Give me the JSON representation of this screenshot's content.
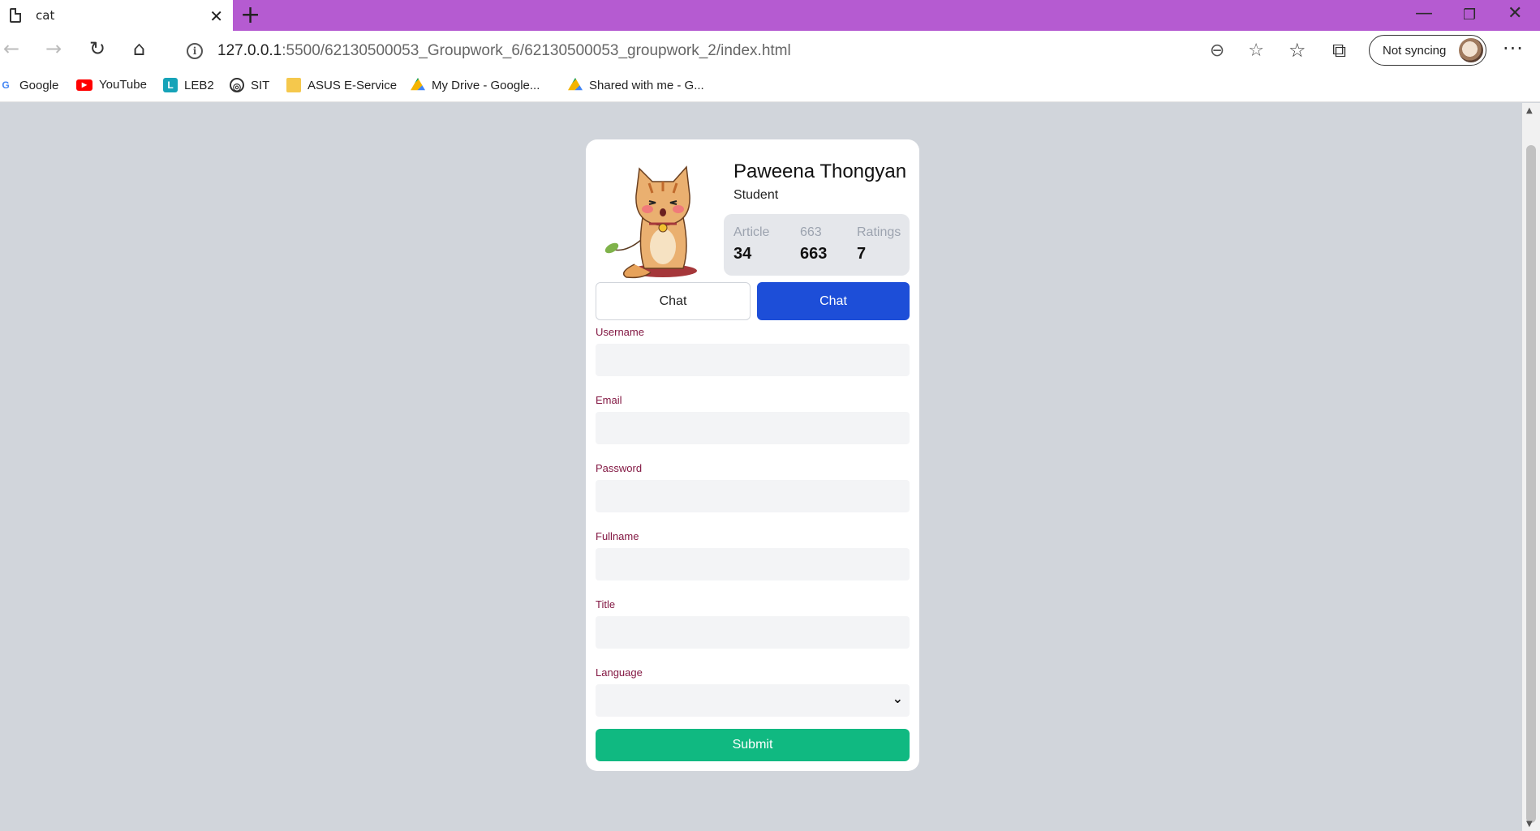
{
  "browser": {
    "tab_title": "cat",
    "url_host": "127.0.0.1",
    "url_path": ":5500/62130500053_Groupwork_6/62130500053_groupwork_2/index.html",
    "sync_label": "Not syncing",
    "accent_color": "#b55bd1"
  },
  "bookmarks": [
    {
      "label": "Google",
      "icon": "google-icon"
    },
    {
      "label": "YouTube",
      "icon": "youtube-icon"
    },
    {
      "label": "LEB2",
      "icon": "leb2-icon"
    },
    {
      "label": "SIT",
      "icon": "sit-icon"
    },
    {
      "label": "ASUS E-Service",
      "icon": "folder-icon"
    },
    {
      "label": "My Drive - Google...",
      "icon": "drive-icon"
    },
    {
      "label": "Shared with me - G...",
      "icon": "drive-icon"
    }
  ],
  "profile": {
    "name": "Paweena Thongyan",
    "role": "Student",
    "stats": [
      {
        "label": "Article",
        "value": "34"
      },
      {
        "label": "663",
        "value": "663"
      },
      {
        "label": "Ratings",
        "value": "7"
      }
    ],
    "button_left": "Chat",
    "button_right": "Chat"
  },
  "form": {
    "fields": [
      {
        "label": "Username",
        "value": ""
      },
      {
        "label": "Email",
        "value": ""
      },
      {
        "label": "Password",
        "value": ""
      },
      {
        "label": "Fullname",
        "value": ""
      },
      {
        "label": "Title",
        "value": ""
      },
      {
        "label": "Language",
        "value": ""
      }
    ],
    "submit_label": "Submit",
    "colors": {
      "label": "#831843",
      "primary_button": "#1d4ed8",
      "submit_button": "#10b981",
      "background": "#d1d5db"
    }
  }
}
